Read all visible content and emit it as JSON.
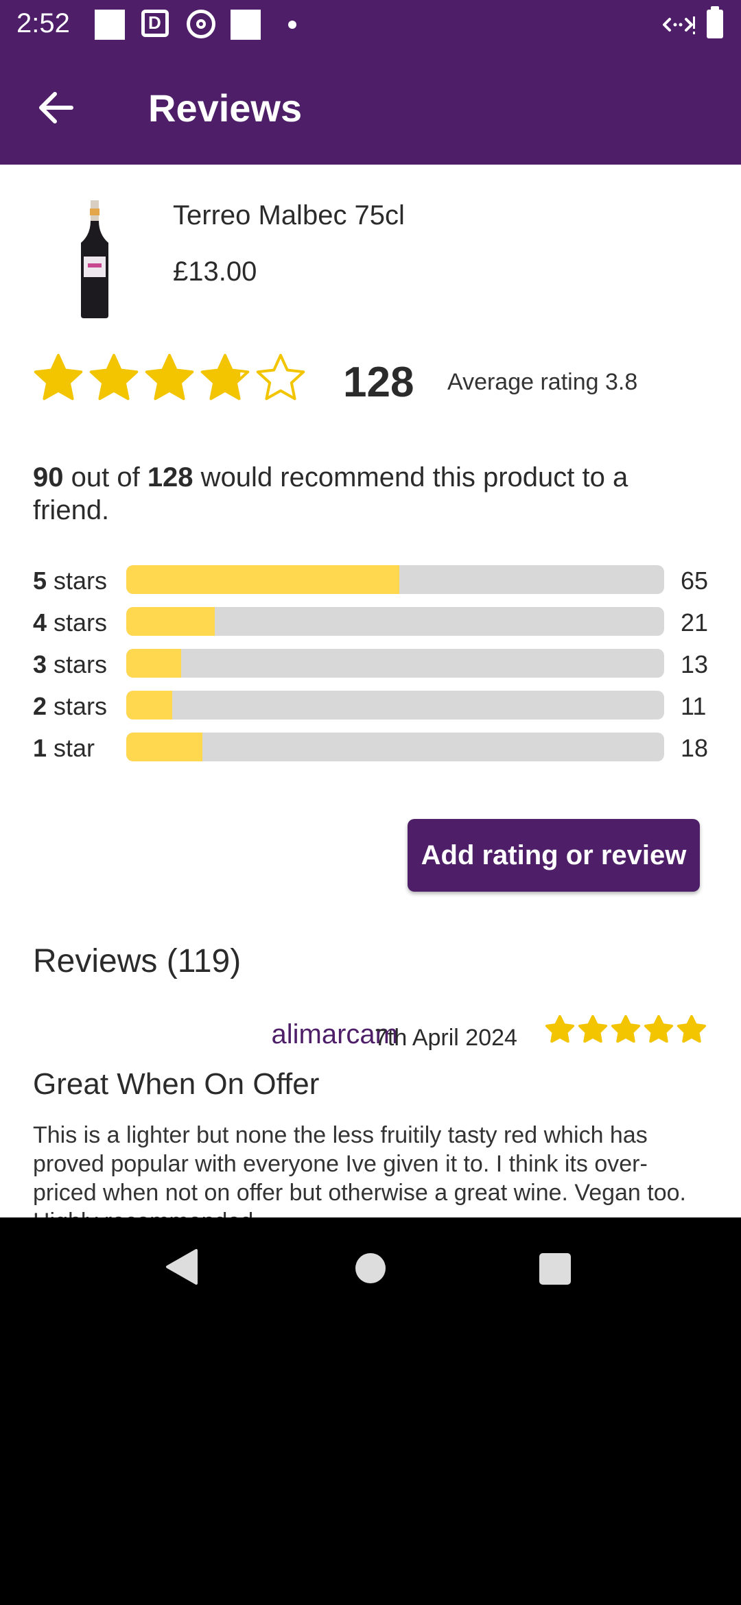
{
  "status_bar": {
    "time": "2:52",
    "icons": [
      "notification-square-icon",
      "news-icon",
      "target-icon",
      "notification-square-icon",
      "dot-icon",
      "wifi-icon",
      "battery-icon"
    ]
  },
  "app_bar": {
    "title": "Reviews",
    "back_icon": "arrow-left-icon"
  },
  "product": {
    "name": "Terreo Malbec 75cl",
    "price": "£13.00"
  },
  "summary": {
    "stars": 3.8,
    "count": "128",
    "average_label": "Average rating 3.8"
  },
  "recommend": {
    "recommend_count": "90",
    "mid_text": " out of ",
    "total": "128",
    "tail_text": " would recommend this product to a friend."
  },
  "distribution": [
    {
      "num": "5",
      "unit": " stars",
      "count": "65",
      "fraction": 0.508
    },
    {
      "num": "4",
      "unit": " stars",
      "count": "21",
      "fraction": 0.164
    },
    {
      "num": "3",
      "unit": " stars",
      "count": "13",
      "fraction": 0.102
    },
    {
      "num": "2",
      "unit": " stars",
      "count": "11",
      "fraction": 0.086
    },
    {
      "num": "1",
      "unit": " star",
      "count": "18",
      "fraction": 0.141
    }
  ],
  "add_review_label": "Add rating or review",
  "reviews_heading": "Reviews (119)",
  "review": {
    "author": "alimarcam",
    "date": "7th April 2024",
    "stars": 5,
    "title": "Great When On Offer",
    "body": "This is a lighter but none the less fruitily tasty red which has proved popular with everyone Ive given it to. I think its over-priced when not on offer but otherwise a great wine. Vegan too. Highly recommended."
  },
  "colors": {
    "brand": "#4e1f68",
    "star": "#f2c500",
    "bar_fill": "#ffd84f",
    "bar_track": "#d8d8d8"
  }
}
